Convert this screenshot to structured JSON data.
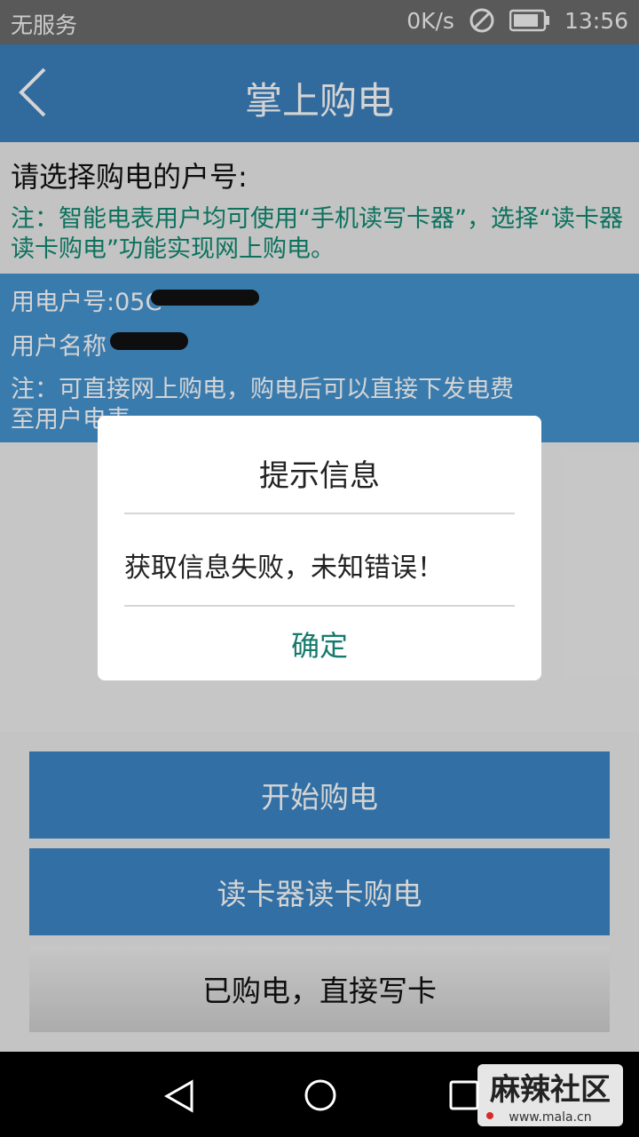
{
  "status_bar": {
    "carrier": "无服务",
    "net_speed": "0K/s",
    "time": "13:56",
    "icons": [
      "no-sim-icon",
      "battery-icon"
    ]
  },
  "app_bar": {
    "title": "掌上购电",
    "back_icon": "back-chevron-icon"
  },
  "account_select": {
    "prompt": "请选择购电的户号:",
    "note": "注：智能电表用户均可使用“手机读写卡器”，选择“读卡器读卡购电”功能实现网上购电。"
  },
  "account_card": {
    "account_no_label": "用电户号:05C",
    "user_name_label": "用户名称",
    "note_line1": "注：可直接网上购电，购电后可以直接下发电费",
    "note_line2": "至用户电表"
  },
  "buttons": {
    "start_purchase": "开始购电",
    "card_reader_purchase": "读卡器读卡购电",
    "write_card": "已购电，直接写卡"
  },
  "dialog": {
    "title": "提示信息",
    "message": "获取信息失败，未知错误！",
    "confirm": "确定"
  },
  "nav": {
    "icons": [
      "back-icon",
      "home-icon",
      "recent-apps-icon"
    ]
  },
  "watermark": {
    "brand": "麻辣社区",
    "url": "www.mala.cn"
  },
  "colors": {
    "app_bar": "#3b80bd",
    "account_card": "#4694d2",
    "note_green": "#0f8a72",
    "button_blue": "#3c86c6",
    "confirm_teal": "#167a6d"
  }
}
